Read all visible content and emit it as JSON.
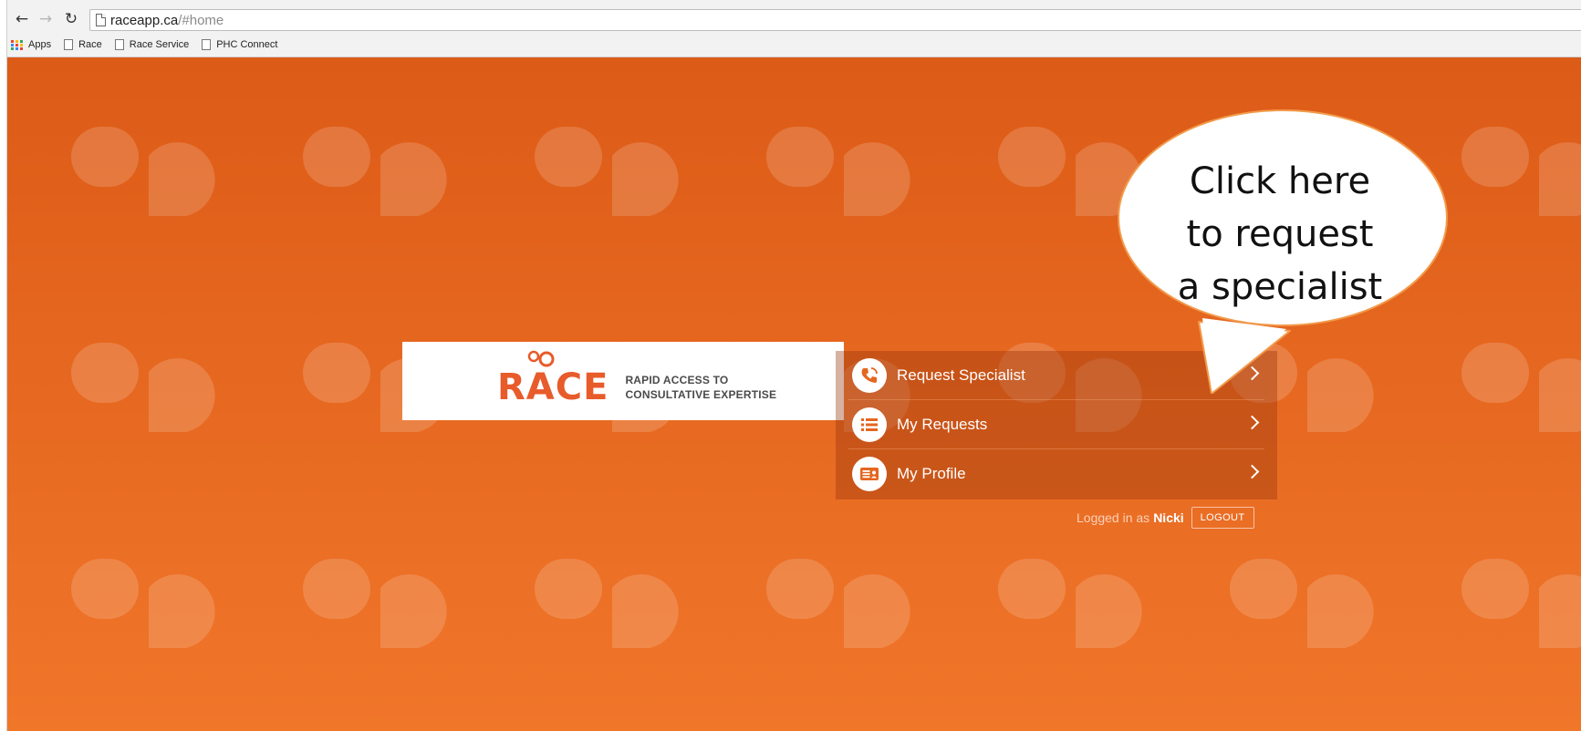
{
  "browser": {
    "url_host": "raceapp.ca",
    "url_path": "/#home",
    "bookmarks": [
      {
        "label": "Apps",
        "icon": "apps-grid-icon"
      },
      {
        "label": "Race",
        "icon": "document-icon"
      },
      {
        "label": "Race Service",
        "icon": "document-icon"
      },
      {
        "label": "PHC Connect",
        "icon": "document-icon"
      }
    ]
  },
  "logo": {
    "wordmark": "RACE",
    "tagline_line1": "RAPID ACCESS TO",
    "tagline_line2": "CONSULTATIVE EXPERTISE",
    "accent_color": "#e85b2a"
  },
  "menu": {
    "items": [
      {
        "label": "Request Specialist",
        "icon": "phone-icon"
      },
      {
        "label": "My Requests",
        "icon": "list-icon"
      },
      {
        "label": "My Profile",
        "icon": "id-card-icon"
      }
    ]
  },
  "session": {
    "prefix": "Logged in as",
    "user": "Nicki",
    "logout_label": "LOGOUT"
  },
  "callout": {
    "line1": "Click here",
    "line2": "to request",
    "line3": "a specialist"
  },
  "colors": {
    "brand_orange": "#e5661f",
    "text_white": "#ffffff"
  }
}
